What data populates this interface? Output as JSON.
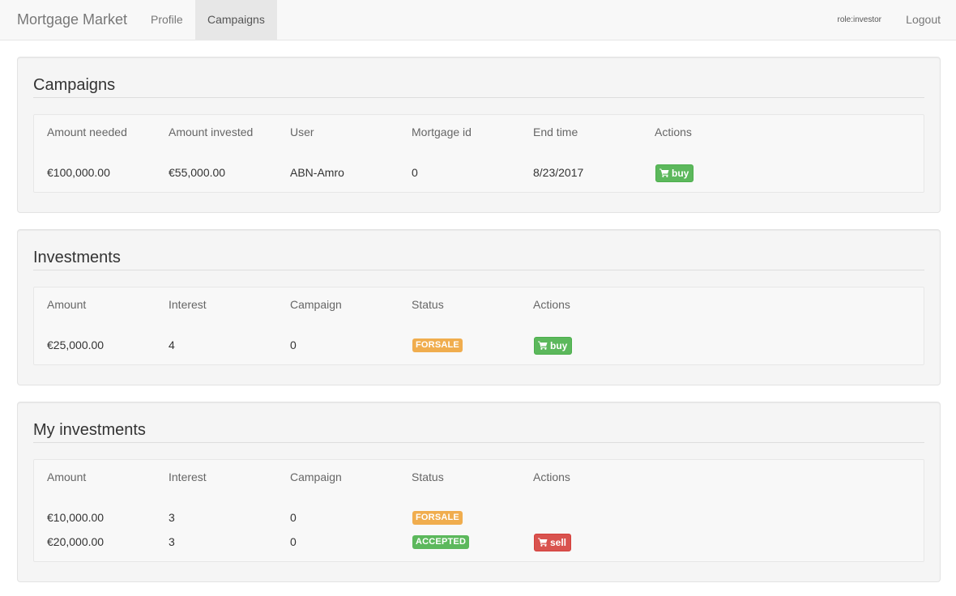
{
  "navbar": {
    "brand": "Mortgage Market",
    "links": [
      {
        "label": "Profile",
        "active": false
      },
      {
        "label": "Campaigns",
        "active": true
      }
    ],
    "role": "role:investor",
    "logout": "Logout"
  },
  "campaigns": {
    "title": "Campaigns",
    "headers": [
      "Amount needed",
      "Amount invested",
      "User",
      "Mortgage id",
      "End time",
      "Actions"
    ],
    "rows": [
      {
        "amount_needed": "€100,000.00",
        "amount_invested": "€55,000.00",
        "user": "ABN-Amro",
        "mortgage_id": "0",
        "end_time": "8/23/2017",
        "action": "buy"
      }
    ]
  },
  "investments": {
    "title": "Investments",
    "headers": [
      "Amount",
      "Interest",
      "Campaign",
      "Status",
      "Actions"
    ],
    "rows": [
      {
        "amount": "€25,000.00",
        "interest": "4",
        "campaign": "0",
        "status": "FORSALE",
        "action": "buy"
      }
    ]
  },
  "my_investments": {
    "title": "My investments",
    "headers": [
      "Amount",
      "Interest",
      "Campaign",
      "Status",
      "Actions"
    ],
    "rows": [
      {
        "amount": "€10,000.00",
        "interest": "3",
        "campaign": "0",
        "status": "FORSALE",
        "action": ""
      },
      {
        "amount": "€20,000.00",
        "interest": "3",
        "campaign": "0",
        "status": "ACCEPTED",
        "action": "sell"
      }
    ]
  },
  "colors": {
    "navbar_bg": "#f8f8f8",
    "well_bg": "#f5f5f5",
    "label_warning": "#f0ad4e",
    "label_success": "#5cb85c",
    "btn_success": "#5cb85c",
    "btn_danger": "#d9534f"
  },
  "icons": {
    "buy": "shopping-cart-icon",
    "sell": "shopping-cart-icon"
  }
}
